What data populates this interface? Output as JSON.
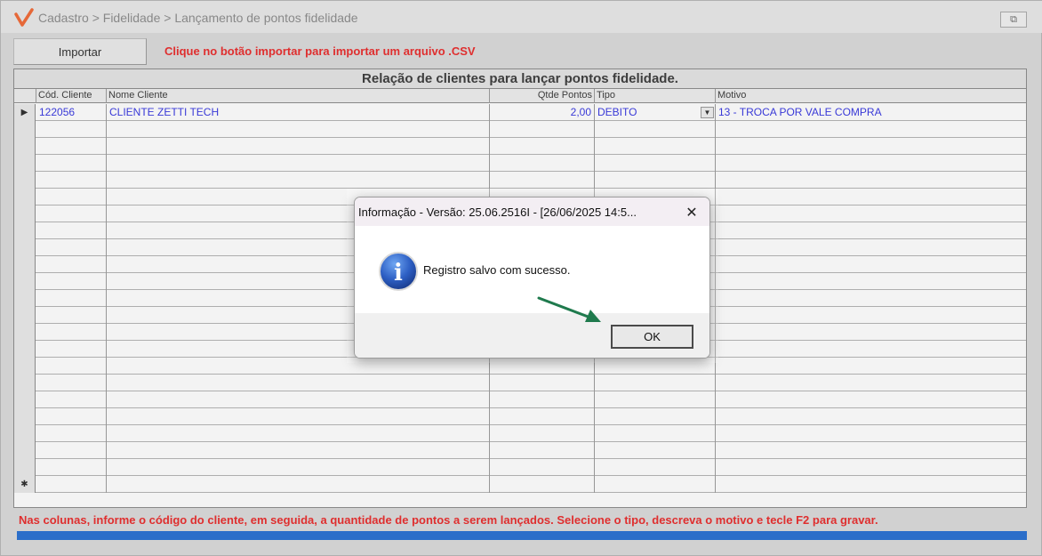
{
  "window": {
    "title": "Cadastro > Fidelidade > Lançamento de pontos fidelidade",
    "restore_symbol": "⧉"
  },
  "toolbar": {
    "import_label": "Importar",
    "hint": "Clique no botão importar para importar um arquivo .CSV"
  },
  "grid": {
    "caption": "Relação de clientes para lançar pontos fidelidade.",
    "columns": [
      "Cód. Cliente",
      "Nome Cliente",
      "Qtde Pontos",
      "Tipo",
      "Motivo"
    ],
    "rows": [
      {
        "codigo": "122056",
        "nome": "CLIENTE ZETTI TECH",
        "qtde": "2,00",
        "tipo": "DEBITO",
        "motivo": "13 - TROCA POR VALE COMPRA"
      }
    ],
    "current_row_marker": "▶",
    "new_row_marker": "✱",
    "combo_symbol": "▼"
  },
  "footer": {
    "instructions": "Nas colunas, informe o código do cliente, em seguida, a quantidade de pontos a serem lançados. Selecione o tipo, descreva o motivo e tecle F2 para gravar."
  },
  "dialog": {
    "title": "Informação - Versão: 25.06.2516I - [26/06/2025 14:5...",
    "close_symbol": "✕",
    "icon_letter": "i",
    "message": "Registro salvo com sucesso.",
    "ok_label": "OK"
  },
  "colors": {
    "accent_red": "#e01010",
    "link_blue": "#1a1ad6",
    "progress_blue": "#0c5bc6",
    "arrow_green": "#1f7a4d"
  }
}
